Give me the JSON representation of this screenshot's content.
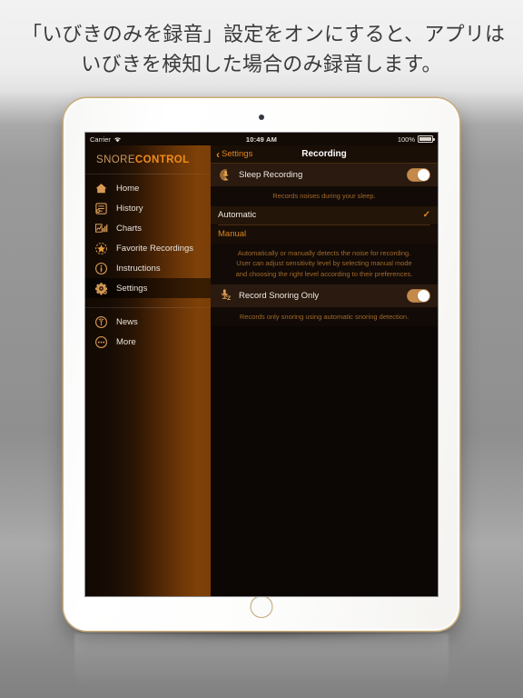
{
  "caption": {
    "line1": "「いびきのみを録音」設定をオンにすると、アプリは",
    "line2": "いびきを検知した場合のみ録音します。"
  },
  "statusbar": {
    "carrier": "Carrier",
    "wifi_icon": "wifi-icon",
    "time": "10:49 AM",
    "battery_percent": "100%",
    "battery_icon": "battery-icon"
  },
  "sidebar": {
    "logo_part1": "SNORE",
    "logo_part2": "CONTROL",
    "items": [
      {
        "label": "Home",
        "icon": "home-icon",
        "active": false
      },
      {
        "label": "History",
        "icon": "history-icon",
        "active": false
      },
      {
        "label": "Charts",
        "icon": "charts-icon",
        "active": false
      },
      {
        "label": "Favorite Recordings",
        "icon": "star-icon",
        "active": false
      },
      {
        "label": "Instructions",
        "icon": "info-icon",
        "active": false
      },
      {
        "label": "Settings",
        "icon": "gear-icon",
        "active": true
      }
    ],
    "secondary_items": [
      {
        "label": "News",
        "icon": "news-icon"
      },
      {
        "label": "More",
        "icon": "ellipsis-icon"
      }
    ]
  },
  "navbar": {
    "back_label": "Settings",
    "back_icon": "chevron-left-icon",
    "title": "Recording"
  },
  "settings": {
    "sleep_recording": {
      "label": "Sleep Recording",
      "icon": "moon-mic-icon",
      "toggle_state": "on",
      "hint": "Records noises during your sleep."
    },
    "mode_options": [
      {
        "label": "Automatic",
        "selected": true,
        "check_icon": "checkmark-icon"
      },
      {
        "label": "Manual",
        "selected": false
      }
    ],
    "mode_hint": "Automatically or manually detects the noise for recording. User can adjust sensitivity level by selecting manual mode and choosing the right level according to their preferences.",
    "record_snoring_only": {
      "label": "Record Snoring Only",
      "icon": "mic-zz-icon",
      "toggle_state": "on",
      "hint": "Records only snoring using automatic snoring detection."
    }
  },
  "colors": {
    "accent_orange": "#e0861f",
    "logo_orange": "#f08c19",
    "toggle_on": "#c58a4a",
    "sidebar_brown": "#7a3e08"
  }
}
